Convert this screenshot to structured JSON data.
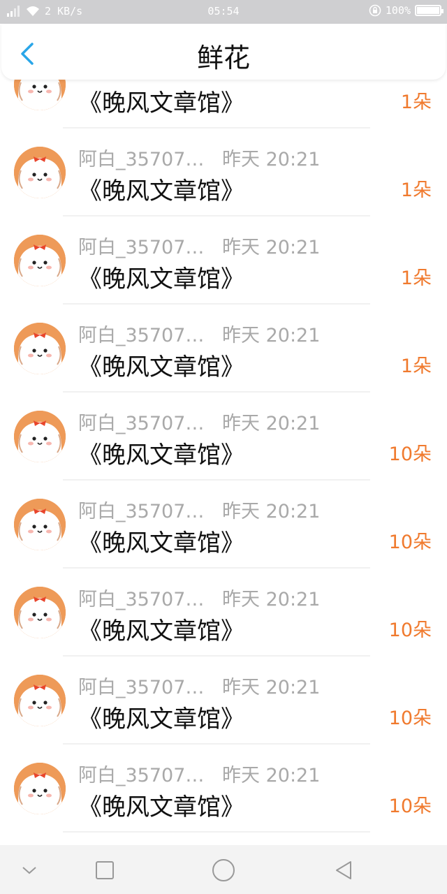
{
  "status_bar": {
    "network_speed": "2 KB/s",
    "time": "05:54",
    "battery_percent": "100%"
  },
  "header": {
    "title": "鲜花",
    "back_icon": "chevron-left-icon",
    "accent_color": "#2aa6e8"
  },
  "colors": {
    "amount": "#f07a2e",
    "meta_text": "#a9a9a9",
    "avatar_bg": "#ee9a58"
  },
  "rows": [
    {
      "name": "",
      "time": "",
      "title": "《晚风文章馆》",
      "amount": "1朵"
    },
    {
      "name": "阿白_35707…",
      "time": "昨天 20:21",
      "title": "《晚风文章馆》",
      "amount": "1朵"
    },
    {
      "name": "阿白_35707…",
      "time": "昨天 20:21",
      "title": "《晚风文章馆》",
      "amount": "1朵"
    },
    {
      "name": "阿白_35707…",
      "time": "昨天 20:21",
      "title": "《晚风文章馆》",
      "amount": "1朵"
    },
    {
      "name": "阿白_35707…",
      "time": "昨天 20:21",
      "title": "《晚风文章馆》",
      "amount": "10朵"
    },
    {
      "name": "阿白_35707…",
      "time": "昨天 20:21",
      "title": "《晚风文章馆》",
      "amount": "10朵"
    },
    {
      "name": "阿白_35707…",
      "time": "昨天 20:21",
      "title": "《晚风文章馆》",
      "amount": "10朵"
    },
    {
      "name": "阿白_35707…",
      "time": "昨天 20:21",
      "title": "《晚风文章馆》",
      "amount": "10朵"
    },
    {
      "name": "阿白_35707…",
      "time": "昨天 20:21",
      "title": "《晚风文章馆》",
      "amount": "10朵"
    }
  ],
  "nav_bar": {
    "icons": [
      "chevron-down-icon",
      "recent-apps-icon",
      "home-icon",
      "back-triangle-icon"
    ]
  }
}
